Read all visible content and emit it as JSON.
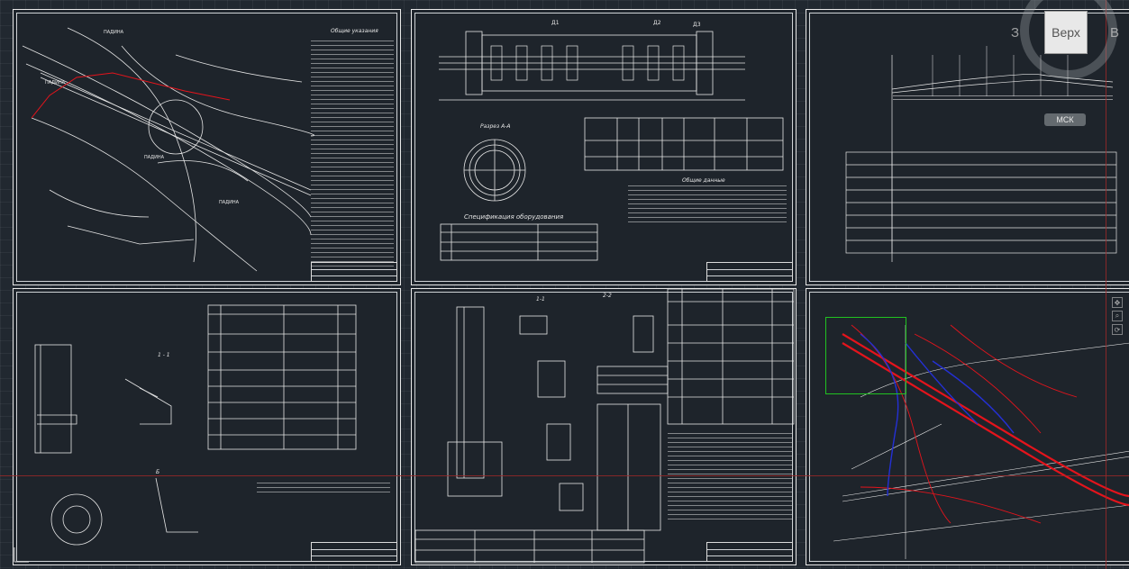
{
  "viewcube": {
    "face_label": "Верх",
    "west_label": "З",
    "east_label": "В",
    "ucs_label": "МСК"
  },
  "sheets": {
    "s1": {
      "notes_title": "Общие указания"
    },
    "s2": {
      "section_label": "Разрез А-А",
      "spec_title": "Спецификация оборудования",
      "notes_title": "Общие данные",
      "callouts": [
        "Д1",
        "Д2",
        "Д3"
      ]
    },
    "s5": {
      "view_labels": [
        "1-1",
        "2-2"
      ]
    },
    "s4": {
      "view_labels": [
        "1 - 1",
        "Б"
      ]
    }
  },
  "colors": {
    "background": "#212830",
    "sheet_border": "#e8e8e8",
    "red_lines": "#e4141c",
    "blue_lines": "#2430d6",
    "selection": "#21c221"
  }
}
